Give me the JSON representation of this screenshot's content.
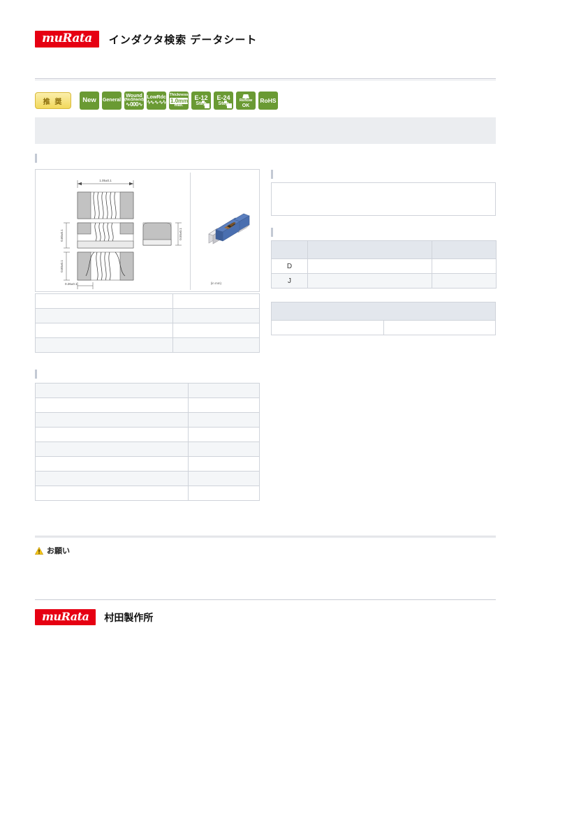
{
  "header": {
    "logo_text": "muRata",
    "title": "インダクタ検索  データシート"
  },
  "badges": {
    "recommend": {
      "label": "推 奨",
      "name": "recommended-badge"
    },
    "items": [
      {
        "name": "new-badge",
        "l1": "New",
        "l2": "",
        "l3": ""
      },
      {
        "name": "general-badge",
        "l1": "General",
        "l2": "",
        "l3": ""
      },
      {
        "name": "wound-noshield-badge",
        "l1": "Wound",
        "l2": "(NoShield)",
        "l3": "∿000∿"
      },
      {
        "name": "low-rdc-badge",
        "l1": "LowRdc",
        "l2": "ϟ∿∿∿ϟ",
        "l3": ""
      },
      {
        "name": "thickness-badge",
        "l1": "Thickness",
        "l2": "1.0mm",
        "l3": "max."
      },
      {
        "name": "e12-step-badge",
        "l1": "E-12",
        "l2": "Step",
        "l3": ""
      },
      {
        "name": "e24-step-badge",
        "l1": "E-24",
        "l2": "Step",
        "l3": ""
      },
      {
        "name": "reflow-ok-badge",
        "l1": "Reflow",
        "l2": "OK",
        "l3": ""
      },
      {
        "name": "rohs-badge",
        "l1": "RoHS",
        "l2": "",
        "l3": ""
      }
    ]
  },
  "banner": {
    "text": ""
  },
  "sections": {
    "dimensions_label": "",
    "part_number_label": "",
    "specifications_label": "",
    "description_label": "",
    "tolerance_label": "",
    "packaging_label": ""
  },
  "drawing": {
    "dim_length": "1.05±0.1",
    "dim_width": "0.60±0.1",
    "dim_width2": "0.60±0.1",
    "dim_terminal": "0.26±0.1",
    "dim_height": "0.55±0.1",
    "unit_note": "(in mm)",
    "product_photo_alt": "chip-inductor-photo"
  },
  "part_table": {
    "rows": [
      {
        "label": "",
        "value": ""
      },
      {
        "label": "",
        "value": ""
      },
      {
        "label": "",
        "value": ""
      },
      {
        "label": "",
        "value": ""
      }
    ]
  },
  "spec_table": {
    "rows": [
      {
        "label": "",
        "value": ""
      },
      {
        "label": "",
        "value": ""
      },
      {
        "label": "",
        "value": ""
      },
      {
        "label": "",
        "value": ""
      },
      {
        "label": "",
        "value": ""
      },
      {
        "label": "",
        "value": ""
      },
      {
        "label": "",
        "value": ""
      },
      {
        "label": "",
        "value": ""
      }
    ]
  },
  "description_box": {
    "text": ""
  },
  "tolerance_table": {
    "headers": [
      "",
      "",
      ""
    ],
    "rows": [
      {
        "code": "D",
        "desc": "",
        "value": ""
      },
      {
        "code": "J",
        "desc": "",
        "value": ""
      }
    ]
  },
  "packaging_table": {
    "header": "",
    "rows": [
      {
        "label": "",
        "value": ""
      }
    ]
  },
  "note": {
    "icon": "warning-triangle-icon",
    "text": "お願い"
  },
  "footer": {
    "logo_text": "muRata",
    "company": "村田製作所"
  },
  "colors": {
    "brand_red": "#e60012",
    "badge_green": "#6a9a33",
    "recommend_yellow": "#f2d95c",
    "table_header": "#e3e7ed",
    "table_alt": "#f4f6f8",
    "border": "#cfd3da",
    "banner_gray": "#ebedf0"
  }
}
